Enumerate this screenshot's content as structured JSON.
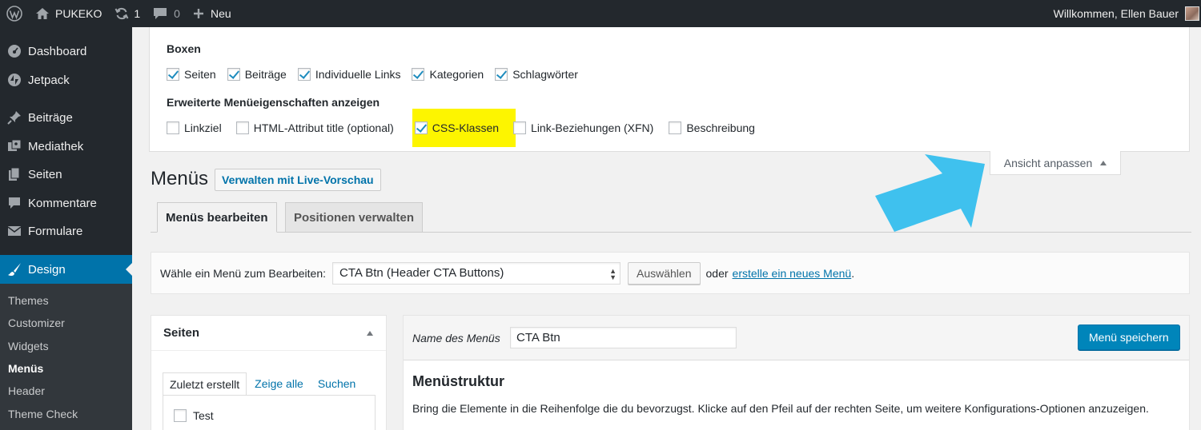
{
  "adminbar": {
    "site_name": "PUKEKO",
    "updates_count": "1",
    "comments_count": "0",
    "new_label": "Neu",
    "greeting": "Willkommen, Ellen Bauer"
  },
  "sidebar": {
    "items": [
      {
        "label": "Dashboard",
        "icon": "dashboard-icon"
      },
      {
        "label": "Jetpack",
        "icon": "jetpack-icon"
      },
      {
        "label": "Beiträge",
        "icon": "pin-icon"
      },
      {
        "label": "Mediathek",
        "icon": "media-icon"
      },
      {
        "label": "Seiten",
        "icon": "pages-icon"
      },
      {
        "label": "Kommentare",
        "icon": "comment-icon"
      },
      {
        "label": "Formulare",
        "icon": "envelope-icon"
      },
      {
        "label": "Design",
        "icon": "brush-icon"
      }
    ],
    "submenu": [
      "Themes",
      "Customizer",
      "Widgets",
      "Menüs",
      "Header",
      "Theme Check"
    ]
  },
  "screen_options": {
    "boxes_heading": "Boxen",
    "boxes": [
      {
        "label": "Seiten",
        "checked": true
      },
      {
        "label": "Beiträge",
        "checked": true
      },
      {
        "label": "Individuelle Links",
        "checked": true
      },
      {
        "label": "Kategorien",
        "checked": true
      },
      {
        "label": "Schlagwörter",
        "checked": true
      }
    ],
    "advanced_heading": "Erweiterte Menüeigenschaften anzeigen",
    "advanced": [
      {
        "label": "Linkziel",
        "checked": false
      },
      {
        "label": "HTML-Attribut title (optional)",
        "checked": false
      },
      {
        "label": "CSS-Klassen",
        "checked": true
      },
      {
        "label": "Link-Beziehungen (XFN)",
        "checked": false
      },
      {
        "label": "Beschreibung",
        "checked": false
      }
    ],
    "toggle_label": "Ansicht anpassen",
    "highlight_color": "#fdf500"
  },
  "page": {
    "title": "Menüs",
    "live_preview_button": "Verwalten mit Live-Vorschau",
    "tabs": [
      "Menüs bearbeiten",
      "Positionen verwalten"
    ]
  },
  "manage": {
    "label": "Wähle ein Menü zum Bearbeiten:",
    "selected_menu": "CTA Btn (Header CTA Buttons)",
    "select_button": "Auswählen",
    "or_text": "oder",
    "create_link": "erstelle ein neues Menü",
    "period": "."
  },
  "left_panel": {
    "title": "Seiten",
    "tabs": [
      "Zuletzt erstellt",
      "Zeige alle",
      "Suchen"
    ],
    "items": [
      {
        "label": "Test",
        "checked": false
      }
    ]
  },
  "right_panel": {
    "name_label": "Name des Menüs",
    "name_value": "CTA Btn",
    "save_button": "Menü speichern",
    "structure_title": "Menüstruktur",
    "structure_desc": "Bring die Elemente in die Reihenfolge die du bevorzugst. Klicke auf den Pfeil auf der rechten Seite, um weitere Konfigurations-Optionen anzuzeigen."
  },
  "colors": {
    "accent": "#0073aa",
    "arrow": "#3fc1ee",
    "adminbar": "#23282d"
  }
}
